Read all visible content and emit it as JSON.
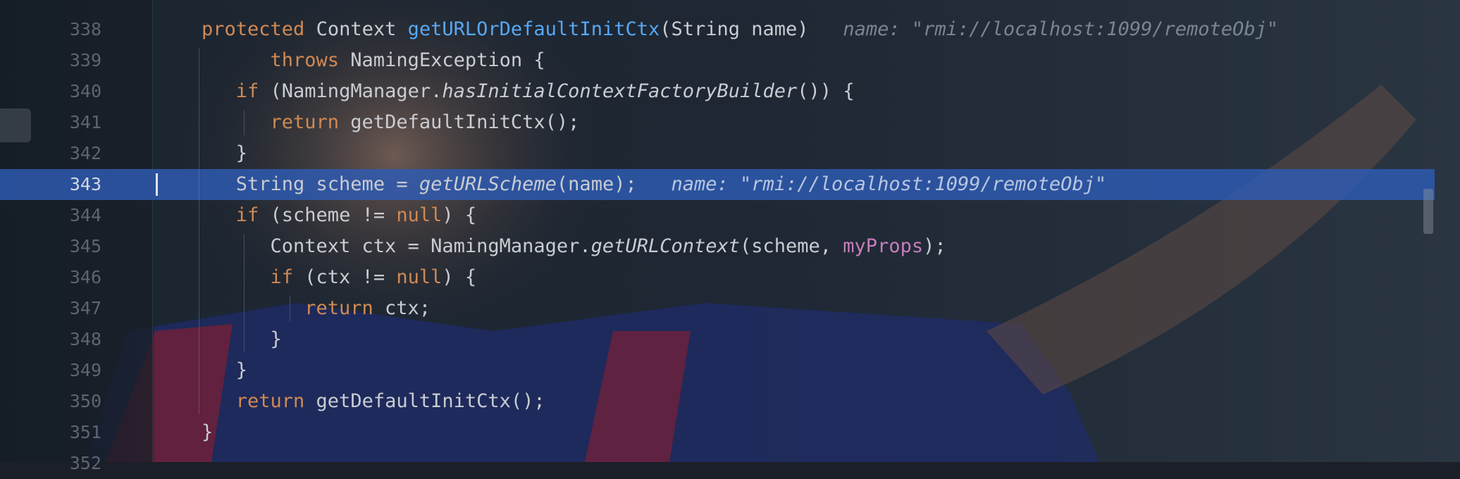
{
  "editor": {
    "current_line": 343,
    "lines": [
      {
        "number": "338",
        "tokens": [
          {
            "t": "protected ",
            "c": "kw"
          },
          {
            "t": "Context "
          },
          {
            "t": "getURLOrDefaultInitCtx",
            "c": "fn"
          },
          {
            "t": "(String name)"
          },
          {
            "t": "   name: \"rmi://localhost:1099/remoteObj\"",
            "c": "hint"
          }
        ],
        "indent": 0
      },
      {
        "number": "339",
        "tokens": [
          {
            "t": "throws ",
            "c": "kw"
          },
          {
            "t": "NamingException {"
          }
        ],
        "indent": 4
      },
      {
        "number": "340",
        "tokens": [
          {
            "t": "if ",
            "c": "kw"
          },
          {
            "t": "(NamingManager."
          },
          {
            "t": "hasInitialContextFactoryBuilder",
            "c": "it"
          },
          {
            "t": "()) {"
          }
        ],
        "indent": 2
      },
      {
        "number": "341",
        "tokens": [
          {
            "t": "return ",
            "c": "kw"
          },
          {
            "t": "getDefaultInitCtx();"
          }
        ],
        "indent": 4
      },
      {
        "number": "342",
        "tokens": [
          {
            "t": "}"
          }
        ],
        "indent": 2
      },
      {
        "number": "343",
        "tokens": [
          {
            "t": "String scheme = "
          },
          {
            "t": "getURLScheme",
            "c": "it"
          },
          {
            "t": "(name);"
          },
          {
            "t": "   name: \"rmi://localhost:1099/remoteObj\"",
            "c": "hint-cur"
          }
        ],
        "indent": 2,
        "current": true
      },
      {
        "number": "344",
        "tokens": [
          {
            "t": "if ",
            "c": "kw"
          },
          {
            "t": "(scheme != "
          },
          {
            "t": "null",
            "c": "kw"
          },
          {
            "t": ") {"
          }
        ],
        "indent": 2
      },
      {
        "number": "345",
        "tokens": [
          {
            "t": "Context ctx = NamingManager."
          },
          {
            "t": "getURLContext",
            "c": "it"
          },
          {
            "t": "(scheme, "
          },
          {
            "t": "myProps",
            "c": "fld"
          },
          {
            "t": ");"
          }
        ],
        "indent": 4
      },
      {
        "number": "346",
        "tokens": [
          {
            "t": "if ",
            "c": "kw"
          },
          {
            "t": "(ctx != "
          },
          {
            "t": "null",
            "c": "kw"
          },
          {
            "t": ") {"
          }
        ],
        "indent": 4
      },
      {
        "number": "347",
        "tokens": [
          {
            "t": "return ",
            "c": "kw"
          },
          {
            "t": "ctx;"
          }
        ],
        "indent": 6
      },
      {
        "number": "348",
        "tokens": [
          {
            "t": "}"
          }
        ],
        "indent": 4
      },
      {
        "number": "349",
        "tokens": [
          {
            "t": "}"
          }
        ],
        "indent": 2
      },
      {
        "number": "350",
        "tokens": [
          {
            "t": "return ",
            "c": "kw"
          },
          {
            "t": "getDefaultInitCtx();"
          }
        ],
        "indent": 2
      },
      {
        "number": "351",
        "tokens": [
          {
            "t": "}"
          }
        ],
        "indent": 0
      },
      {
        "number": "352",
        "tokens": [],
        "indent": 0
      }
    ]
  },
  "colors": {
    "background": "#1b1f27",
    "current_line": "#2e5cb4",
    "keyword": "#d08954",
    "method": "#56a8f5",
    "field": "#c77dbb",
    "hint": "#7b8591"
  }
}
